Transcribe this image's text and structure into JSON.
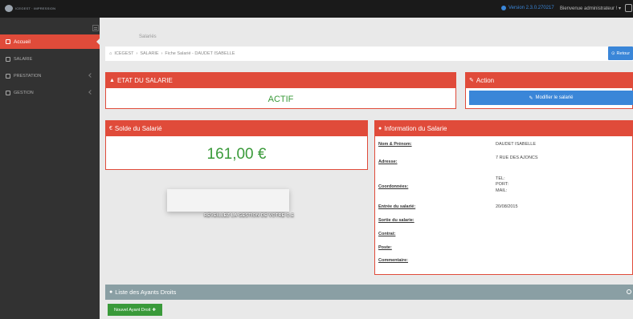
{
  "topbar": {
    "logo_text": "ICEGEST · IMPRESSION",
    "version": "Version 2.3.0.270217",
    "user": "Bienvenue administrateur ! ▾"
  },
  "sidebar": {
    "items": [
      {
        "label": "Accueil",
        "icon": "home-icon"
      },
      {
        "label": "SALARIE",
        "icon": "users-icon"
      },
      {
        "label": "PRESTATION",
        "icon": "list-icon"
      },
      {
        "label": "GESTION",
        "icon": "list-icon"
      }
    ]
  },
  "main": {
    "page_title": "Salariés",
    "breadcrumb": [
      "ICEGEST",
      "SALARIE",
      "Fiche Salarié - DAUDET ISABELLE"
    ],
    "retour_label": "Retour",
    "etat": {
      "title": "ETAT DU SALARIE",
      "value": "ACTIF"
    },
    "action": {
      "title": "Action",
      "modifier_label": "Modifier le salarié"
    },
    "solde": {
      "title": "Solde du Salarié",
      "value": "161,00 €"
    },
    "information": {
      "title": "Information du Salarie",
      "nom_label": "Nom & Prénom:",
      "nom_value": "DAUDET ISABELLE",
      "adresse_label": "Adresse:",
      "adresse_value": "7 RUE DES AJONCS",
      "coord_label": "Coordonnées:",
      "coord_tel": "TEL:",
      "coord_port": "PORT:",
      "coord_mail": "MAIL:",
      "entree_label": "Entrée du salarié:",
      "entree_value": "20/08/2015",
      "sortie_label": "Sortie du salarie:",
      "contrat_label": "Contrat:",
      "poste_label": "Poste:",
      "commentaire_label": "Commentaire:"
    },
    "ad_text": "RÉVEILLEZ LA GESTION DE VOTRE C.E",
    "ayants": {
      "title": "Liste des Ayants Droits",
      "new_label": "Nouvel Ayant Droit"
    }
  },
  "colors": {
    "accent_red": "#e04b3a",
    "accent_blue": "#3a86d8",
    "green": "#3a9a3a",
    "sidebar": "#323232",
    "ayants_head": "#8a9fa4"
  }
}
